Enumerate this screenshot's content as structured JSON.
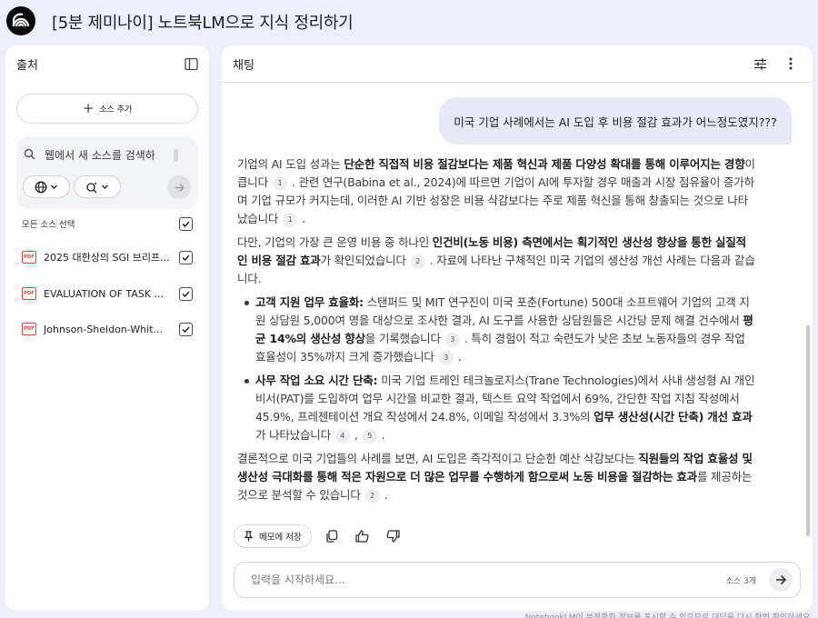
{
  "header": {
    "title": "[5분 제미나이] 노트북LM으로 지식 정리하기"
  },
  "sources_panel": {
    "title": "출처",
    "add_source_label": "소스 추가",
    "search": {
      "placeholder": "웹에서 새 소스를 검색하"
    },
    "select_all_label": "모든 소스 선택",
    "items": [
      {
        "name": "2025 대한상의 SGI 브리프...",
        "type": "PDF",
        "checked": true
      },
      {
        "name": "EVALUATION OF TASK ...",
        "type": "PDF",
        "checked": true
      },
      {
        "name": "Johnson-Sheldon-Whit...",
        "type": "PDF",
        "checked": true
      }
    ]
  },
  "chat_panel": {
    "title": "채팅",
    "user_message": "미국 기업 사례에서는 AI 도입 후 비용 절감 효과가 어느정도였지???",
    "answer": {
      "p1": {
        "t1": "기업의 AI 도입 성과는 ",
        "b1": "단순한 직접적 비용 절감보다는 제품 혁신과 제품 다양성 확대를 통해 이루어지는 경향",
        "t2": "이 큽니다",
        "c1": "1",
        "t3": ". 관련 연구(Babina et al., 2024)에 따르면 기업이 AI에 투자할 경우 매출과 시장 점유율이 증가하며 기업 규모가 커지는데, 이러한 AI 기반 성장은 비용 삭감보다는 주로 제품 혁신을 통해 창출되는 것으로 나타났습니다",
        "c2": "1",
        "t4": "."
      },
      "p2": {
        "t1": "다만, 기업의 가장 큰 운영 비용 중 하나인 ",
        "b1": "인건비(노동 비용) 측면에서는 획기적인 생산성 향상을 통한 실질적인 비용 절감 효과",
        "t2": "가 확인되었습니다",
        "c1": "2",
        "t3": ". 자료에 나타난 구체적인 미국 기업의 생산성 개선 사례는 다음과 같습니다."
      },
      "bullet1": {
        "b1": "고객 지원 업무 효율화:",
        "t1": " 스탠퍼드 및 MIT 연구진이 미국 포춘(Fortune) 500대 소프트웨어 기업의 고객 지원 상담원 5,000여 명을 대상으로 조사한 결과, AI 도구를 사용한 상담원들은 시간당 문제 해결 건수에서 ",
        "b2": "평균 14%의 생산성 향상",
        "t2": "을 기록했습니다",
        "c1": "3",
        "t3": ". 특히 경험이 적고 숙련도가 낮은 초보 노동자들의 경우 작업 효율성이 35%까지 크게 증가했습니다",
        "c2": "3",
        "t4": "."
      },
      "bullet2": {
        "b1": "사무 작업 소요 시간 단축:",
        "t1": " 미국 기업 트레인 테크놀로지스(Trane Technologies)에서 사내 생성형 AI 개인비서(PAT)를 도입하여 업무 시간을 비교한 결과, 텍스트 요약 작업에서 69%, 간단한 작업 지침 작성에서 45.9%, 프레젠테이션 개요 작성에서 24.8%, 이메일 작성에서 3.3%의 ",
        "b2": "업무 생산성(시간 단축) 개선 효과",
        "t2": "가 나타났습니다",
        "c1": "4",
        "sep": ",",
        "c2": "5",
        "t3": "."
      },
      "p3": {
        "t1": "결론적으로 미국 기업들의 사례를 보면, AI 도입은 즉각적이고 단순한 예산 삭감보다는 ",
        "b1": "직원들의 작업 효율성 및 생산성 극대화를 통해 적은 자원으로 더 많은 업무를 수행하게 함으로써 노동 비용을 절감하는 효과",
        "t2": "를 제공하는 것으로 분석할 수 있습니다",
        "c1": "2",
        "t3": "."
      }
    },
    "save_note_label": "메모에 저장",
    "input": {
      "placeholder": "입력을 시작하세요...",
      "source_count": "소스 3개"
    }
  },
  "footer": {
    "note": "NotebookLM이 부정확한 정보를 표시할 수 있으므로 대답을 다시 한번 확인하세요."
  },
  "colors": {
    "background": "#eceef9",
    "panel": "#ffffff",
    "user_bubble": "#e7eaf6",
    "pdf_red": "#e2443c"
  }
}
